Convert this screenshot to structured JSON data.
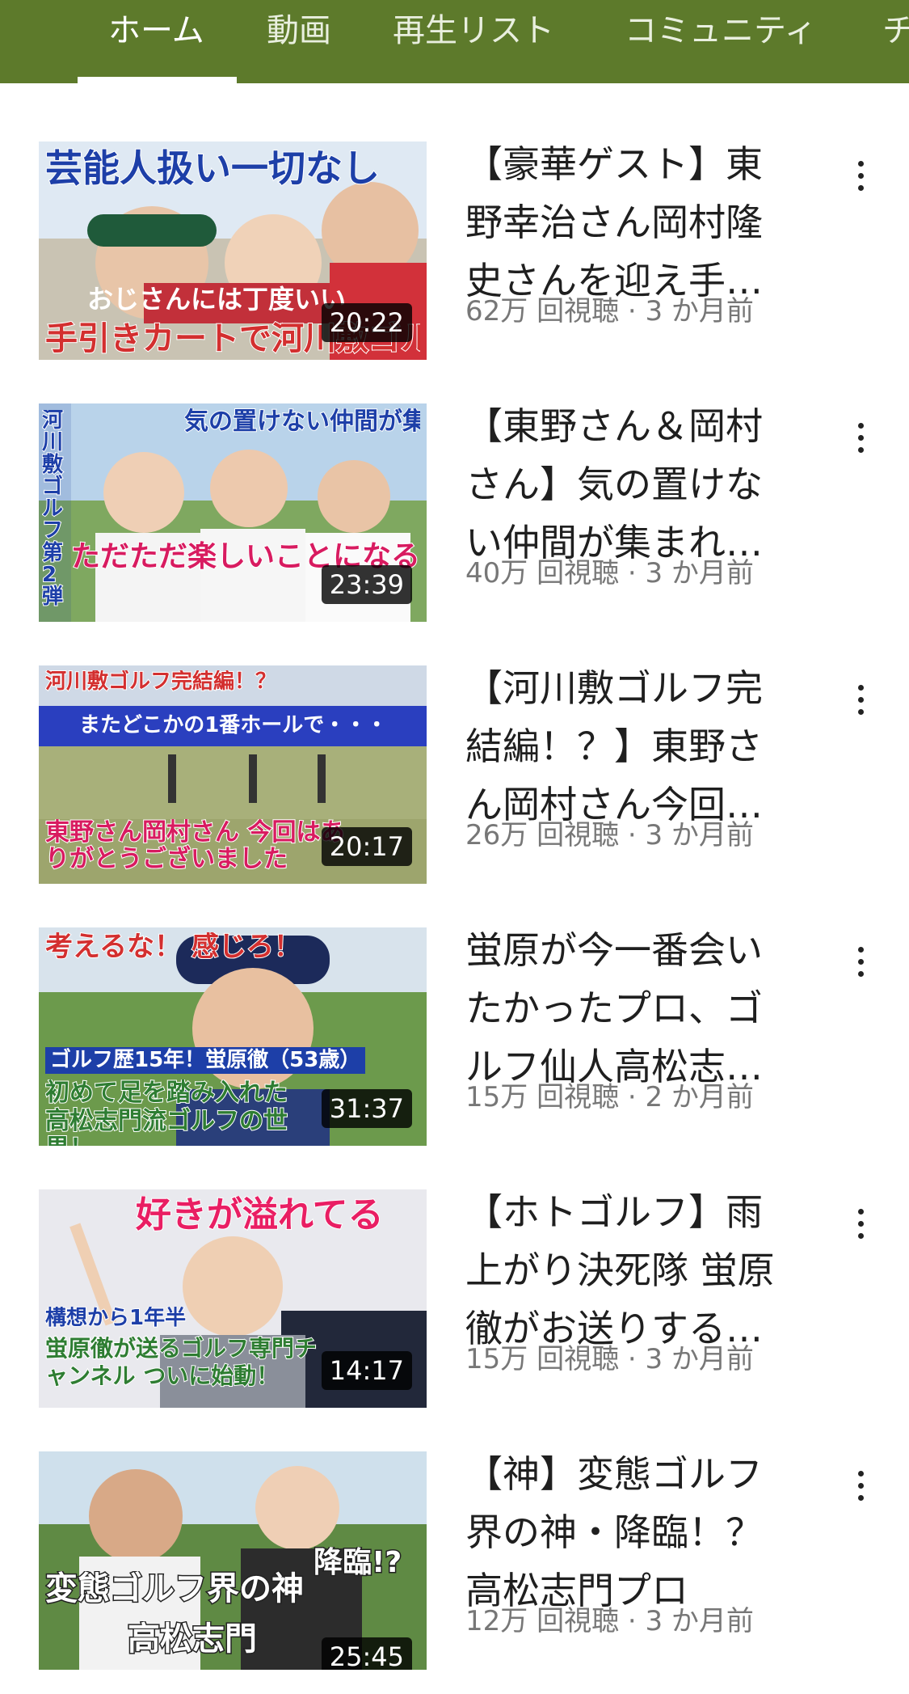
{
  "tabs": [
    {
      "label": "ホーム",
      "active": true
    },
    {
      "label": "動画",
      "active": false
    },
    {
      "label": "再生リスト",
      "active": false
    },
    {
      "label": "コミュニティ",
      "active": false
    },
    {
      "label": "チ",
      "active": false
    }
  ],
  "colors": {
    "topbar": "#5d7a2b",
    "meta": "#777777"
  },
  "videos": [
    {
      "title": "【豪華ゲスト】東野幸治さん岡村隆史さんを迎え手…",
      "meta": "62万 回視聴 · 3 か月前",
      "duration": "20:22",
      "thumb_text": {
        "line1": "芸能人扱い一切なし",
        "line2": "おじさんには丁度いい",
        "line3": "手引きカートで河川敷ゴルフ"
      }
    },
    {
      "title": "【東野さん＆岡村さん】気の置けない仲間が集まれ…",
      "meta": "40万 回視聴 · 3 か月前",
      "duration": "23:39",
      "thumb_text": {
        "line1": "気の置けない仲間が集まれば",
        "line2": "ただただ楽しいことになる",
        "line3": "河川敷ゴルフ第2弾"
      }
    },
    {
      "title": "【河川敷ゴルフ完結編！？】東野さん岡村さん今回…",
      "meta": "26万 回視聴 · 3 か月前",
      "duration": "20:17",
      "thumb_text": {
        "line1": "河川敷ゴルフ完結編！？",
        "line2": "またどこかの1番ホールで・・・",
        "line3": "東野さん岡村さん 今回はありがとうございました"
      }
    },
    {
      "title": "蛍原が今一番会いたかったプロ、ゴルフ仙人高松志…",
      "meta": "15万 回視聴 · 2 か月前",
      "duration": "31:37",
      "thumb_text": {
        "line1": "考えるな！ 感じろ！",
        "line2": "ゴルフ歴15年！蛍原徹（53歳）",
        "line3": "初めて足を踏み入れた 高松志門流ゴルフの世界！"
      }
    },
    {
      "title": "【ホトゴルフ】雨上がり決死隊 蛍原徹がお送りする…",
      "meta": "15万 回視聴 · 3 か月前",
      "duration": "14:17",
      "thumb_text": {
        "line1": "好きが溢れてる",
        "line2": "構想から1年半",
        "line3": "蛍原徹が送るゴルフ専門チャンネル ついに始動！"
      }
    },
    {
      "title": "【神】変態ゴルフ界の神・降臨！？高松志門プロ",
      "meta": "12万 回視聴 · 3 か月前",
      "duration": "25:45",
      "thumb_text": {
        "line1": "変態ゴルフ界の神",
        "line2": "降臨!?",
        "line3": "高松志門"
      }
    }
  ]
}
